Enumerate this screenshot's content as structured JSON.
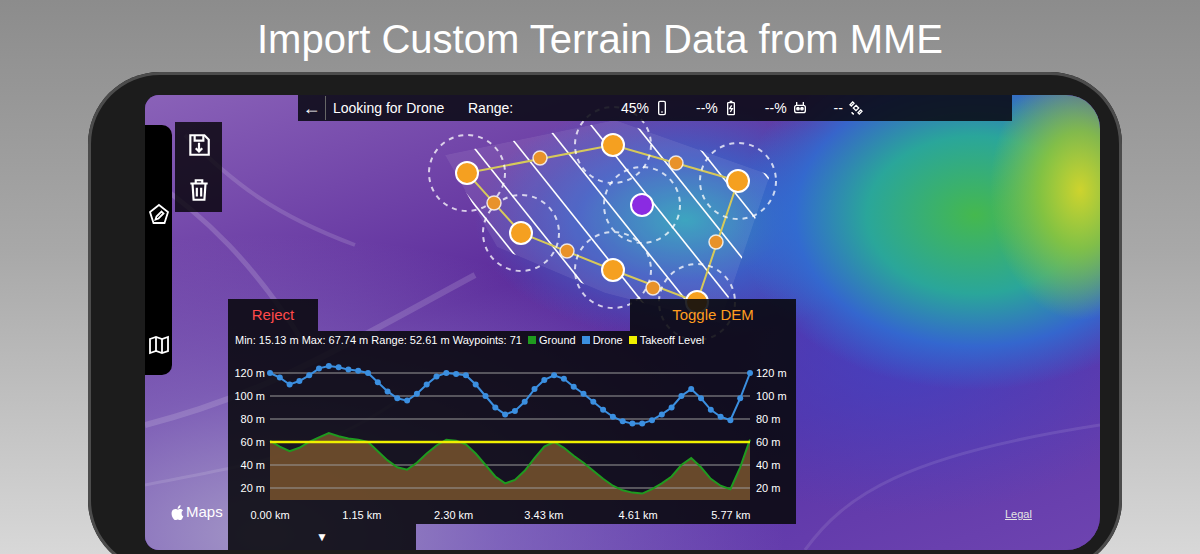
{
  "headline": "Import Custom Terrain Data from MME",
  "status_bar": {
    "back": "←",
    "connection": "Looking for Drone",
    "range_label": "Range:",
    "phone_battery": "45%",
    "drone_battery": "--%",
    "controller_signal": "--%",
    "satellites": "--"
  },
  "actions": [
    {
      "label": "Reject",
      "color": "#ff4a4a"
    },
    {
      "label": "Toggle DEM",
      "color": "#ff9d1f"
    }
  ],
  "profile": {
    "summary": "Min: 15.13 m Max: 67.74 m Range: 52.61 m Waypoints: 71",
    "series": [
      {
        "name": "Ground",
        "kind": "area",
        "color": "#1f9a1f",
        "values": [
          61,
          56,
          52,
          55,
          60,
          64,
          67.74,
          65,
          63,
          62,
          60,
          52,
          44,
          38,
          36,
          42,
          50,
          57,
          62,
          61,
          58,
          50,
          40,
          30,
          24,
          27,
          35,
          46,
          56,
          60,
          55,
          48,
          42,
          35,
          28,
          22,
          18,
          16,
          15.13,
          19,
          24,
          30,
          40,
          46,
          38,
          28,
          22,
          19,
          38,
          62
        ]
      },
      {
        "name": "Drone",
        "kind": "points",
        "color": "#3b8fe0",
        "values": [
          120,
          116,
          110,
          113,
          118,
          124,
          126,
          125,
          123,
          122,
          120,
          112,
          104,
          98,
          96,
          102,
          110,
          117,
          120,
          119,
          118,
          110,
          100,
          90,
          84,
          87,
          95,
          106,
          114,
          118,
          115,
          108,
          102,
          95,
          88,
          82,
          78,
          76,
          76,
          79,
          84,
          90,
          100,
          106,
          98,
          88,
          82,
          79,
          98,
          120
        ]
      },
      {
        "name": "Takeoff Level",
        "kind": "level",
        "color": "#f0f000",
        "values": [
          60
        ]
      }
    ],
    "y_ticks": [
      {
        "label": "120 m",
        "value": 120
      },
      {
        "label": "100 m",
        "value": 100
      },
      {
        "label": "80 m",
        "value": 80
      },
      {
        "label": "60 m",
        "value": 60
      },
      {
        "label": "40 m",
        "value": 40
      },
      {
        "label": "20 m",
        "value": 20
      }
    ],
    "x_ticks": [
      {
        "label": "0.00 km",
        "value": 0
      },
      {
        "label": "1.15 km",
        "value": 1.15
      },
      {
        "label": "2.30 km",
        "value": 2.3
      },
      {
        "label": "3.43 km",
        "value": 3.43
      },
      {
        "label": "4.61 km",
        "value": 4.61
      },
      {
        "label": "5.77 km",
        "value": 5.77
      }
    ],
    "x_max_km": 6.01
  },
  "drawer_toggle": "▼",
  "map": {
    "attribution": "Maps",
    "legal": "Legal"
  }
}
